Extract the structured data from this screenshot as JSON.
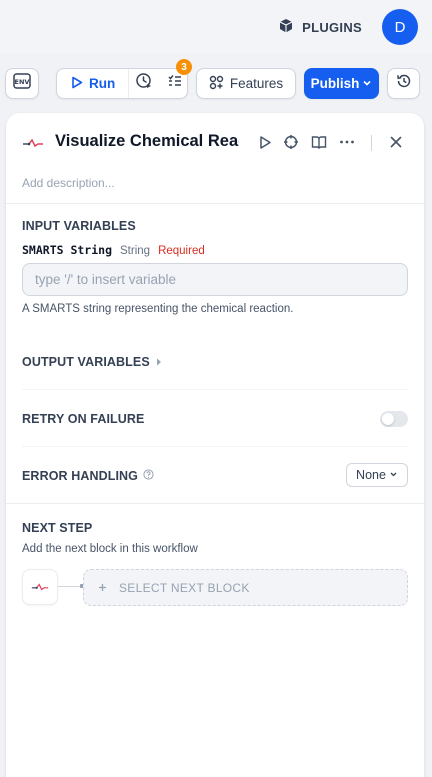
{
  "header": {
    "plugins_label": "PLUGINS",
    "avatar_initial": "D",
    "accent_color": "#155eef"
  },
  "toolbar": {
    "env_label": "ENV",
    "run_label": "Run",
    "checklist_count": "3",
    "features_label": "Features",
    "publish_label": "Publish"
  },
  "panel": {
    "title": "Visualize Chemical Reacti",
    "description_placeholder": "Add description...",
    "input_section_title": "INPUT VARIABLES",
    "variable": {
      "name": "SMARTS String",
      "type": "String",
      "required": "Required",
      "placeholder": "type '/' to insert variable",
      "help": "A SMARTS string representing the chemical reaction."
    },
    "output_section_title": "OUTPUT VARIABLES",
    "retry_title": "RETRY ON FAILURE",
    "retry_enabled": false,
    "error_title": "ERROR HANDLING",
    "error_value": "None",
    "next_step_title": "NEXT STEP",
    "next_step_sub": "Add the next block in this workflow",
    "select_next_label": "SELECT NEXT BLOCK"
  }
}
